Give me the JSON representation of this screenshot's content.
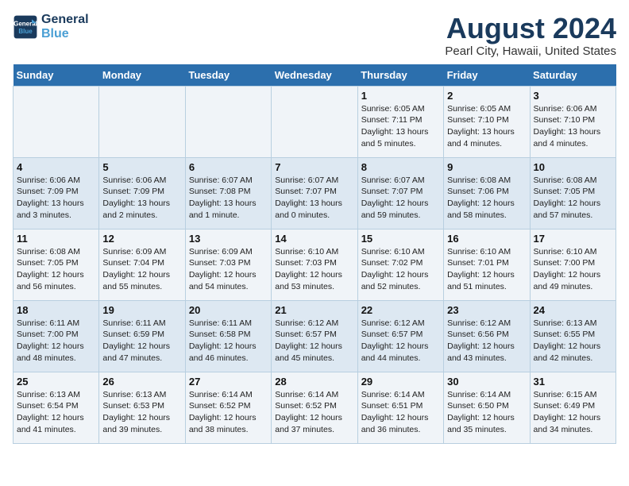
{
  "logo": {
    "line1": "General",
    "line2": "Blue"
  },
  "title": "August 2024",
  "subtitle": "Pearl City, Hawaii, United States",
  "days_of_week": [
    "Sunday",
    "Monday",
    "Tuesday",
    "Wednesday",
    "Thursday",
    "Friday",
    "Saturday"
  ],
  "weeks": [
    [
      {
        "day": "",
        "info": ""
      },
      {
        "day": "",
        "info": ""
      },
      {
        "day": "",
        "info": ""
      },
      {
        "day": "",
        "info": ""
      },
      {
        "day": "1",
        "info": "Sunrise: 6:05 AM\nSunset: 7:11 PM\nDaylight: 13 hours\nand 5 minutes."
      },
      {
        "day": "2",
        "info": "Sunrise: 6:05 AM\nSunset: 7:10 PM\nDaylight: 13 hours\nand 4 minutes."
      },
      {
        "day": "3",
        "info": "Sunrise: 6:06 AM\nSunset: 7:10 PM\nDaylight: 13 hours\nand 4 minutes."
      }
    ],
    [
      {
        "day": "4",
        "info": "Sunrise: 6:06 AM\nSunset: 7:09 PM\nDaylight: 13 hours\nand 3 minutes."
      },
      {
        "day": "5",
        "info": "Sunrise: 6:06 AM\nSunset: 7:09 PM\nDaylight: 13 hours\nand 2 minutes."
      },
      {
        "day": "6",
        "info": "Sunrise: 6:07 AM\nSunset: 7:08 PM\nDaylight: 13 hours\nand 1 minute."
      },
      {
        "day": "7",
        "info": "Sunrise: 6:07 AM\nSunset: 7:07 PM\nDaylight: 13 hours\nand 0 minutes."
      },
      {
        "day": "8",
        "info": "Sunrise: 6:07 AM\nSunset: 7:07 PM\nDaylight: 12 hours\nand 59 minutes."
      },
      {
        "day": "9",
        "info": "Sunrise: 6:08 AM\nSunset: 7:06 PM\nDaylight: 12 hours\nand 58 minutes."
      },
      {
        "day": "10",
        "info": "Sunrise: 6:08 AM\nSunset: 7:05 PM\nDaylight: 12 hours\nand 57 minutes."
      }
    ],
    [
      {
        "day": "11",
        "info": "Sunrise: 6:08 AM\nSunset: 7:05 PM\nDaylight: 12 hours\nand 56 minutes."
      },
      {
        "day": "12",
        "info": "Sunrise: 6:09 AM\nSunset: 7:04 PM\nDaylight: 12 hours\nand 55 minutes."
      },
      {
        "day": "13",
        "info": "Sunrise: 6:09 AM\nSunset: 7:03 PM\nDaylight: 12 hours\nand 54 minutes."
      },
      {
        "day": "14",
        "info": "Sunrise: 6:10 AM\nSunset: 7:03 PM\nDaylight: 12 hours\nand 53 minutes."
      },
      {
        "day": "15",
        "info": "Sunrise: 6:10 AM\nSunset: 7:02 PM\nDaylight: 12 hours\nand 52 minutes."
      },
      {
        "day": "16",
        "info": "Sunrise: 6:10 AM\nSunset: 7:01 PM\nDaylight: 12 hours\nand 51 minutes."
      },
      {
        "day": "17",
        "info": "Sunrise: 6:10 AM\nSunset: 7:00 PM\nDaylight: 12 hours\nand 49 minutes."
      }
    ],
    [
      {
        "day": "18",
        "info": "Sunrise: 6:11 AM\nSunset: 7:00 PM\nDaylight: 12 hours\nand 48 minutes."
      },
      {
        "day": "19",
        "info": "Sunrise: 6:11 AM\nSunset: 6:59 PM\nDaylight: 12 hours\nand 47 minutes."
      },
      {
        "day": "20",
        "info": "Sunrise: 6:11 AM\nSunset: 6:58 PM\nDaylight: 12 hours\nand 46 minutes."
      },
      {
        "day": "21",
        "info": "Sunrise: 6:12 AM\nSunset: 6:57 PM\nDaylight: 12 hours\nand 45 minutes."
      },
      {
        "day": "22",
        "info": "Sunrise: 6:12 AM\nSunset: 6:57 PM\nDaylight: 12 hours\nand 44 minutes."
      },
      {
        "day": "23",
        "info": "Sunrise: 6:12 AM\nSunset: 6:56 PM\nDaylight: 12 hours\nand 43 minutes."
      },
      {
        "day": "24",
        "info": "Sunrise: 6:13 AM\nSunset: 6:55 PM\nDaylight: 12 hours\nand 42 minutes."
      }
    ],
    [
      {
        "day": "25",
        "info": "Sunrise: 6:13 AM\nSunset: 6:54 PM\nDaylight: 12 hours\nand 41 minutes."
      },
      {
        "day": "26",
        "info": "Sunrise: 6:13 AM\nSunset: 6:53 PM\nDaylight: 12 hours\nand 39 minutes."
      },
      {
        "day": "27",
        "info": "Sunrise: 6:14 AM\nSunset: 6:52 PM\nDaylight: 12 hours\nand 38 minutes."
      },
      {
        "day": "28",
        "info": "Sunrise: 6:14 AM\nSunset: 6:52 PM\nDaylight: 12 hours\nand 37 minutes."
      },
      {
        "day": "29",
        "info": "Sunrise: 6:14 AM\nSunset: 6:51 PM\nDaylight: 12 hours\nand 36 minutes."
      },
      {
        "day": "30",
        "info": "Sunrise: 6:14 AM\nSunset: 6:50 PM\nDaylight: 12 hours\nand 35 minutes."
      },
      {
        "day": "31",
        "info": "Sunrise: 6:15 AM\nSunset: 6:49 PM\nDaylight: 12 hours\nand 34 minutes."
      }
    ]
  ]
}
